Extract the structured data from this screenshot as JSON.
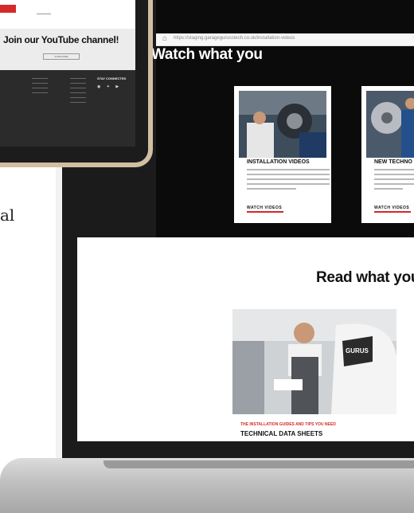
{
  "side_text": "al",
  "browser": {
    "url": "https://staging.garagegurusstech.co.uk/installation-videos"
  },
  "watch_section": {
    "heading": "Watch what you",
    "cards": [
      {
        "title": "INSTALLATION VIDEOS",
        "link_label": "WATCH VIDEOS"
      },
      {
        "title": "NEW TECHNO",
        "link_label": "WATCH VIDEOS"
      }
    ]
  },
  "read_section": {
    "heading": "Read what you",
    "badge_text": "GURUS",
    "subtitle": "THE INSTALLATION GUIDES AND TIPS YOU NEED",
    "title": "TECHNICAL DATA SHEETS"
  },
  "tablet": {
    "youtube_heading": "Join our YouTube channel!",
    "subscribe_label": "SUBSCRIBE",
    "stay_connected": "STAY CONNECTED",
    "social_icons": [
      "facebook-icon",
      "twitter-icon",
      "youtube-icon"
    ]
  },
  "colors": {
    "brand_red": "#d42a2a",
    "dark_bg": "#0b0b0b"
  }
}
